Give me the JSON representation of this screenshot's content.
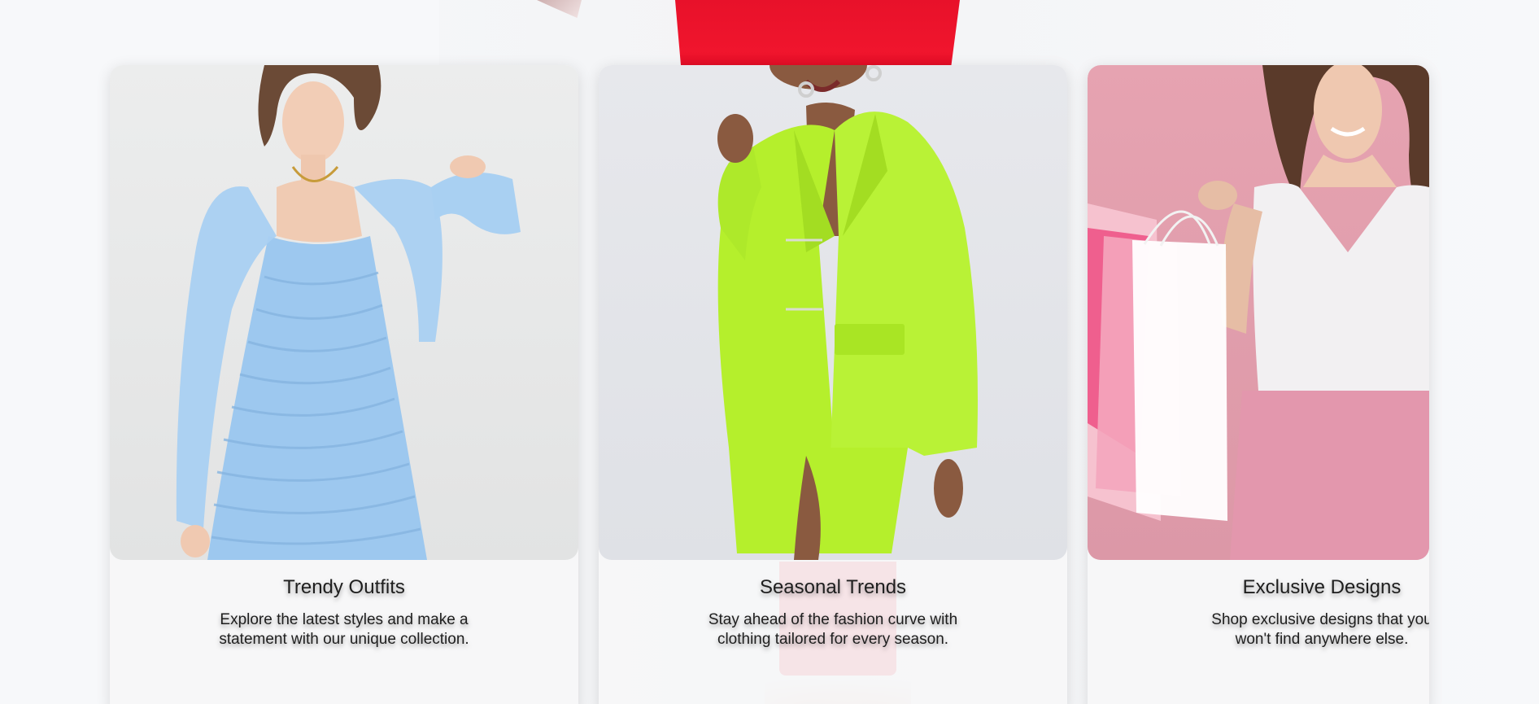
{
  "cards": [
    {
      "title": "Trendy Outfits",
      "description": "Explore the latest styles and make a statement with our unique collection."
    },
    {
      "title": "Seasonal Trends",
      "description": "Stay ahead of the fashion curve with clothing tailored for every season."
    },
    {
      "title": "Exclusive Designs",
      "description": "Shop exclusive designs that you won't find anywhere else."
    }
  ],
  "colors": {
    "background": "#f6f7f9",
    "card_background": "#f7f7f8",
    "text": "#1e1e1e",
    "hero_red": "#ee1530",
    "lime": "#b6f12b",
    "sky_blue": "#9fcaf0",
    "pink": "#e6a3b1"
  }
}
